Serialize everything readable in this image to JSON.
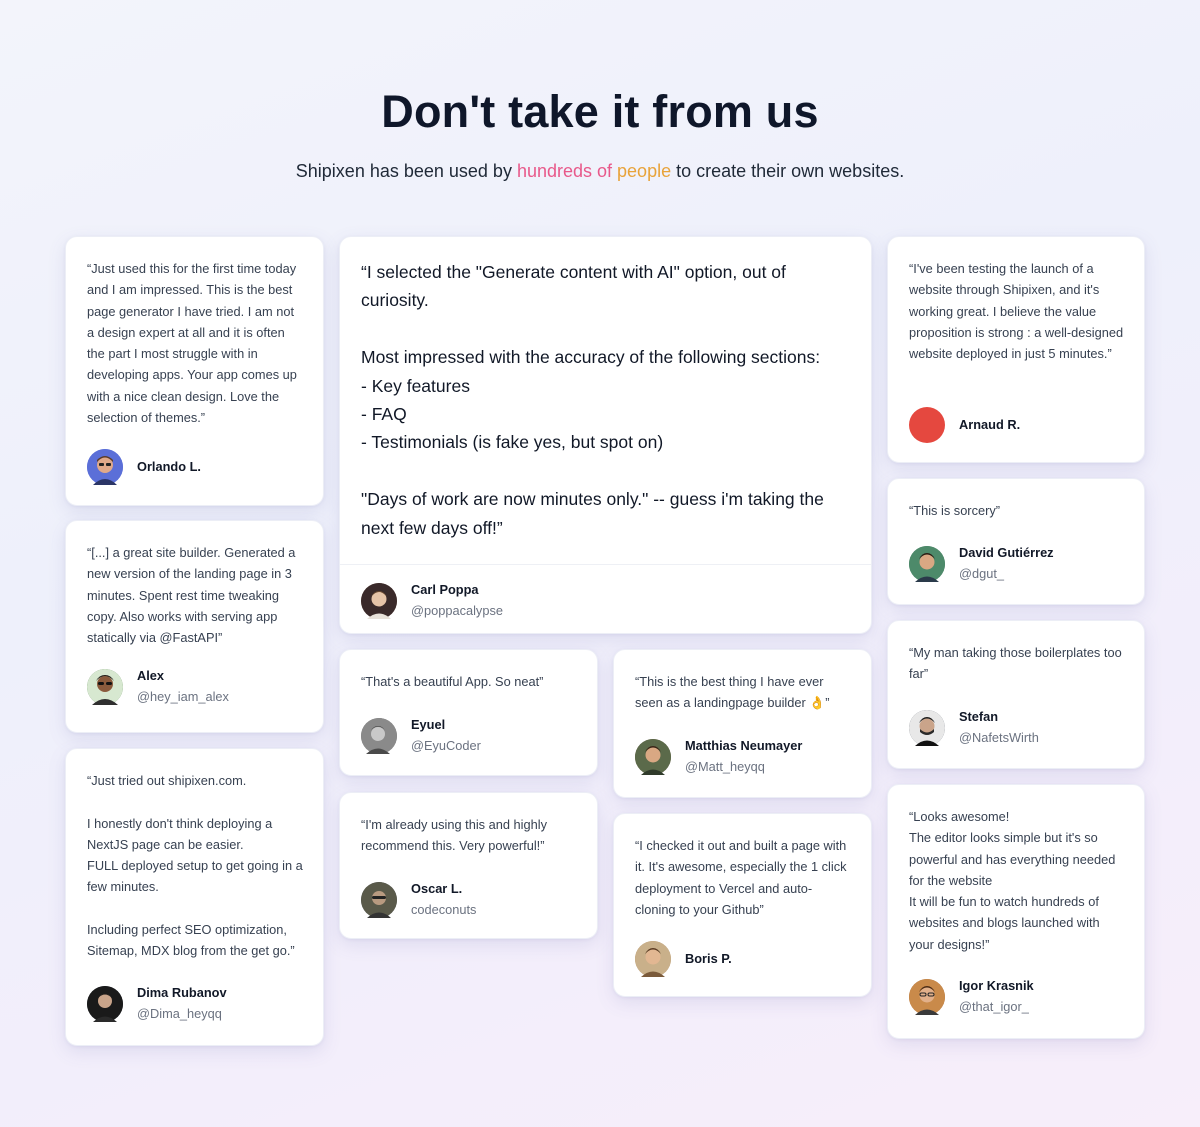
{
  "header": {
    "title": "Don't take it from us",
    "subtitle_before": "Shipixen has been used by ",
    "subtitle_highlight_1": "hundreds of",
    "subtitle_highlight_2": " people",
    "subtitle_after": " to create their own websites."
  },
  "testimonials": [
    {
      "quote": "“Just used this for the first time today and I am impressed. This is the best page generator I have tried. I am not a design expert at all and it is often the part I most struggle with in developing apps. Your app comes up with a nice clean design. Love the selection of themes.”",
      "name": "Orlando L.",
      "handle": "",
      "avatar": "memoji-avatar",
      "avatar_color": "#5b6fd8"
    },
    {
      "quote": "“[...] a great site builder. Generated a new version of the landing page in 3 minutes. Spent rest time tweaking copy. Also works with serving app statically via @FastAPI”",
      "name": "Alex",
      "handle": "@hey_iam_alex",
      "avatar": "person-avatar",
      "avatar_color": "#3f6b3a"
    },
    {
      "quote": "“Just tried out shipixen.com.\n\nI honestly don't think deploying a NextJS page can be easier.\nFULL deployed setup to get going in a few minutes.\n\nIncluding perfect SEO optimization, Sitemap, MDX blog from the get go.”",
      "name": "Dima Rubanov",
      "handle": "@Dima_heyqq",
      "avatar": "person-avatar",
      "avatar_color": "#1f2937"
    },
    {
      "quote": "“I selected the \"Generate content with AI\" option, out of curiosity.\n\nMost impressed with the accuracy of the following sections:\n- Key features\n- FAQ\n- Testimonials (is fake yes, but spot on)\n\n\"Days of work are now minutes only.\" -- guess i'm taking the next few days off!”",
      "name": "Carl Poppa",
      "handle": "@poppacalypse",
      "avatar": "person-avatar",
      "avatar_color": "#8a6a5a"
    },
    {
      "quote": "“That's a beautiful App. So neat”",
      "name": "Eyuel",
      "handle": "@EyuCoder",
      "avatar": "person-avatar",
      "avatar_color": "#6b6b6b"
    },
    {
      "quote": "“I'm already using this and highly recommend this. Very powerful!”",
      "name": "Oscar L.",
      "handle": "codeconuts",
      "avatar": "person-avatar",
      "avatar_color": "#4b5563"
    },
    {
      "quote": "“This is the best thing I have ever seen as a landingpage builder 👌”",
      "name": "Matthias Neumayer",
      "handle": "@Matt_heyqq",
      "avatar": "person-avatar",
      "avatar_color": "#6b4a34"
    },
    {
      "quote": "“I checked it out and built a page with it. It's awesome, especially the 1 click deployment to Vercel and auto-cloning to your Github”",
      "name": "Boris P.",
      "handle": "",
      "avatar": "person-avatar",
      "avatar_color": "#b08458"
    },
    {
      "quote": "“I've been testing the launch of a website through Shipixen, and it's working great. I believe the value proposition is strong : a well-designed website deployed in just 5 minutes.”",
      "name": "Arnaud R.",
      "handle": "",
      "avatar": "red-circle-avatar",
      "avatar_color": "#e5483f"
    },
    {
      "quote": "“This is sorcery”",
      "name": "David Gutiérrez",
      "handle": "@dgut_",
      "avatar": "person-avatar",
      "avatar_color": "#3b6b55"
    },
    {
      "quote": "“My man taking those boilerplates too far”",
      "name": "Stefan",
      "handle": "@NafetsWirth",
      "avatar": "person-avatar",
      "avatar_color": "#374151"
    },
    {
      "quote": "“Looks awesome!\nThe editor looks simple but it's so powerful and has everything needed for the website\nIt will be fun to watch hundreds of websites and blogs launched with your designs!”",
      "name": "Igor Krasnik",
      "handle": "@that_igor_",
      "avatar": "person-avatar",
      "avatar_color": "#9a5a2e"
    }
  ]
}
